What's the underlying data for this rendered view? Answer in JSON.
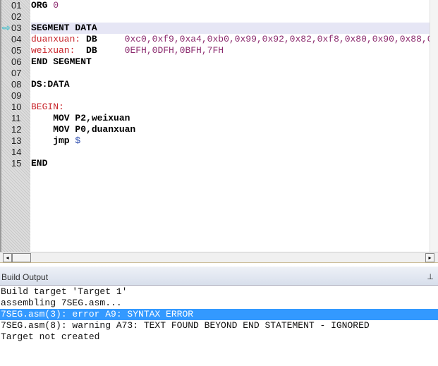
{
  "editor": {
    "current_line": "03",
    "lines": [
      {
        "num": "01",
        "parts": [
          {
            "t": "ORG ",
            "c": ""
          },
          {
            "t": "0",
            "c": "pur"
          }
        ]
      },
      {
        "num": "02",
        "parts": []
      },
      {
        "num": "03",
        "parts": [
          {
            "t": "SEGMENT DATA",
            "c": ""
          }
        ]
      },
      {
        "num": "04",
        "parts": [
          {
            "t": "duanxuan:",
            "c": "red"
          },
          {
            "t": " DB     ",
            "c": ""
          },
          {
            "t": "0xc0,0xf9,0xa4,0xb0,0x99,0x92,0x82,0xf8,0x80,0x90,0x88,0",
            "c": "pur"
          }
        ]
      },
      {
        "num": "05",
        "parts": [
          {
            "t": "weixuan:",
            "c": "red"
          },
          {
            "t": "  DB     ",
            "c": ""
          },
          {
            "t": "0EFH,0DFH,0BFH,7FH",
            "c": "pur"
          }
        ]
      },
      {
        "num": "06",
        "parts": [
          {
            "t": "END SEGMENT",
            "c": ""
          }
        ]
      },
      {
        "num": "07",
        "parts": []
      },
      {
        "num": "08",
        "parts": [
          {
            "t": "DS:DATA",
            "c": ""
          }
        ]
      },
      {
        "num": "09",
        "parts": []
      },
      {
        "num": "10",
        "parts": [
          {
            "t": "BEGIN:",
            "c": "red"
          }
        ]
      },
      {
        "num": "11",
        "parts": [
          {
            "t": "    MOV P2,weixuan",
            "c": ""
          }
        ]
      },
      {
        "num": "12",
        "parts": [
          {
            "t": "    MOV P0,duanxuan",
            "c": ""
          }
        ]
      },
      {
        "num": "13",
        "parts": [
          {
            "t": "    jmp ",
            "c": ""
          },
          {
            "t": "$",
            "c": "blu"
          }
        ]
      },
      {
        "num": "14",
        "parts": []
      },
      {
        "num": "15",
        "parts": [
          {
            "t": "END",
            "c": ""
          }
        ]
      }
    ]
  },
  "build_output": {
    "title": "Build Output",
    "pin_icon": "pin-icon",
    "lines": [
      "Build target 'Target 1'",
      "assembling 7SEG.asm...",
      "7SEG.asm(3): error A9: SYNTAX ERROR",
      "7SEG.asm(8): warning A73: TEXT FOUND BEYOND END STATEMENT - IGNORED",
      "Target not created"
    ],
    "selected_index": 2
  },
  "scroll": {
    "left_arrow": "◂",
    "right_arrow": "▸"
  }
}
